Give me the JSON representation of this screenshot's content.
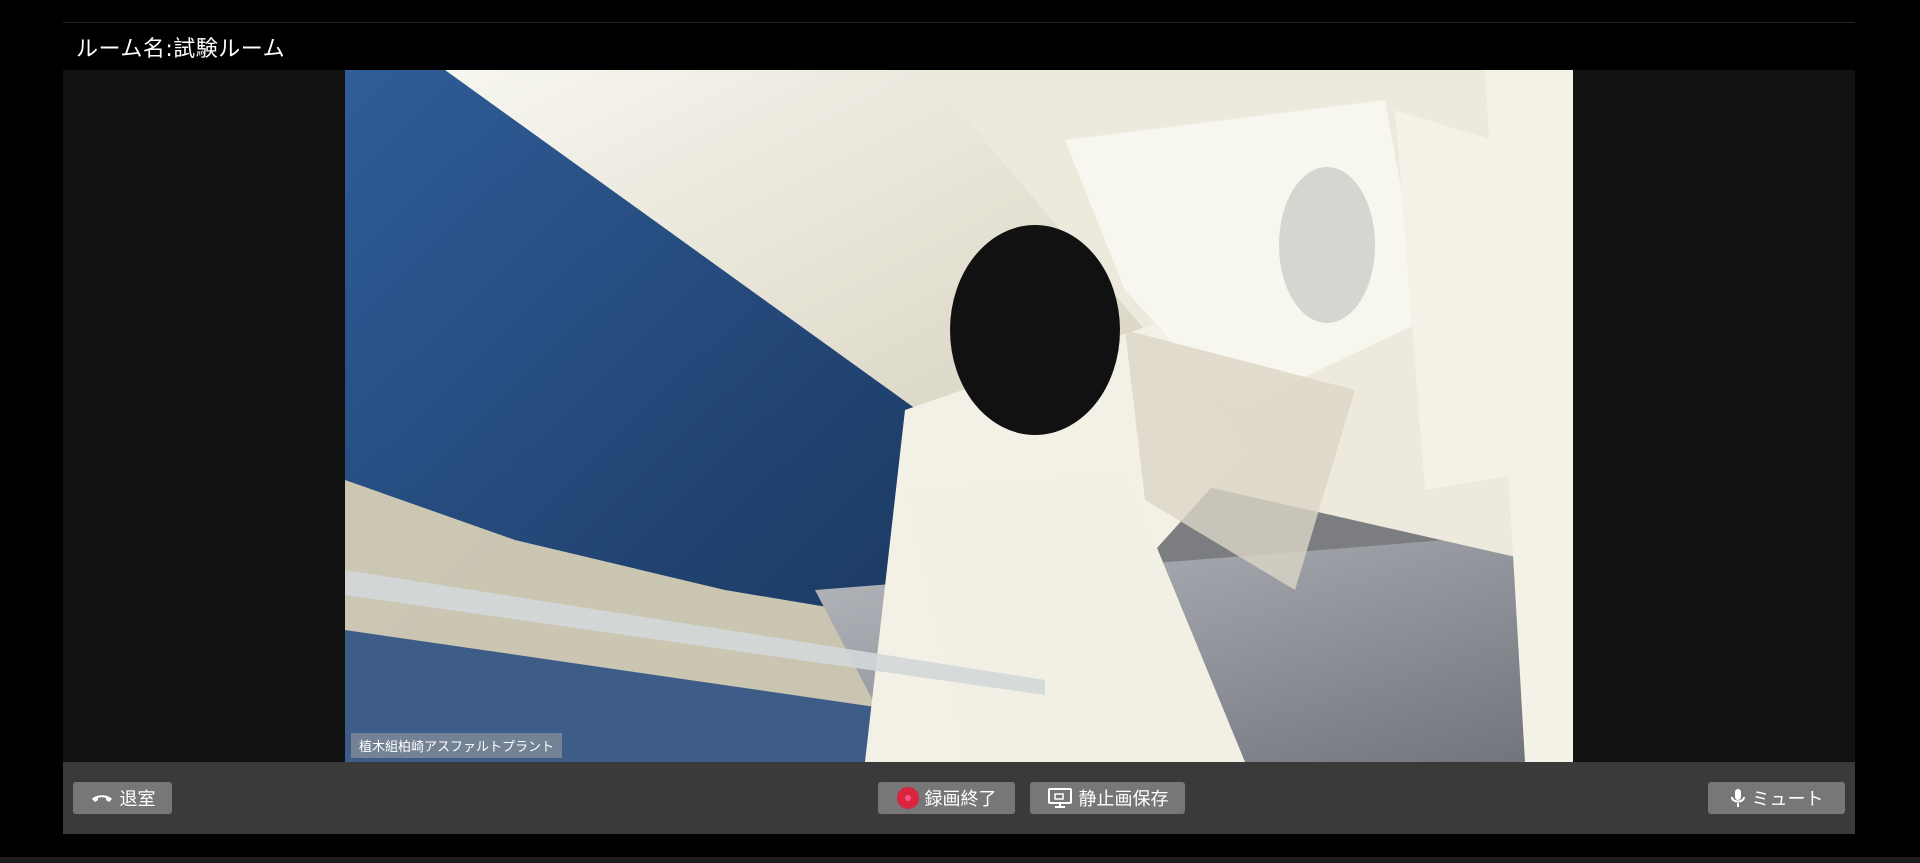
{
  "room": {
    "title": "ルーム名:試験ルーム"
  },
  "video": {
    "feed_label": "植木組柏崎アスファルトプラント"
  },
  "controls": {
    "leave_label": "退室",
    "record_stop_label": "録画終了",
    "capture_label": "静止画保存",
    "mute_label": "ミュート"
  },
  "colors": {
    "background": "#000000",
    "control_bar": "#3a3a3a",
    "button": "#777777",
    "record_dot": "#d8243c"
  },
  "icons": {
    "leave": "phone-hangup-icon",
    "record": "record-dot-icon",
    "capture": "screen-capture-icon",
    "mute": "microphone-icon"
  }
}
